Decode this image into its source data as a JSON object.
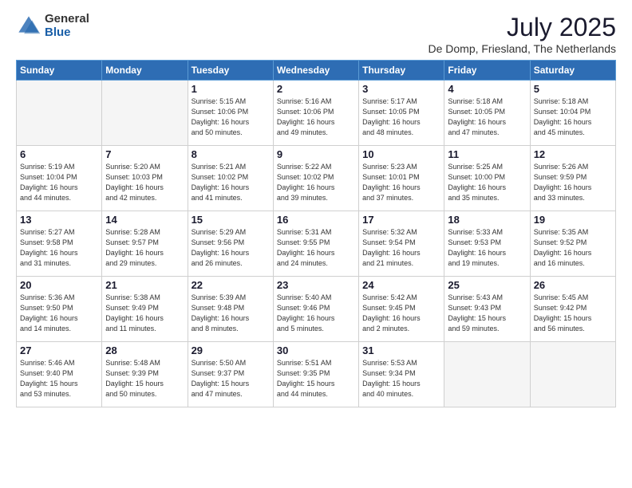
{
  "header": {
    "logo_general": "General",
    "logo_blue": "Blue",
    "title": "July 2025",
    "subtitle": "De Domp, Friesland, The Netherlands"
  },
  "days_of_week": [
    "Sunday",
    "Monday",
    "Tuesday",
    "Wednesday",
    "Thursday",
    "Friday",
    "Saturday"
  ],
  "weeks": [
    [
      {
        "day": "",
        "info": ""
      },
      {
        "day": "",
        "info": ""
      },
      {
        "day": "1",
        "info": "Sunrise: 5:15 AM\nSunset: 10:06 PM\nDaylight: 16 hours\nand 50 minutes."
      },
      {
        "day": "2",
        "info": "Sunrise: 5:16 AM\nSunset: 10:06 PM\nDaylight: 16 hours\nand 49 minutes."
      },
      {
        "day": "3",
        "info": "Sunrise: 5:17 AM\nSunset: 10:05 PM\nDaylight: 16 hours\nand 48 minutes."
      },
      {
        "day": "4",
        "info": "Sunrise: 5:18 AM\nSunset: 10:05 PM\nDaylight: 16 hours\nand 47 minutes."
      },
      {
        "day": "5",
        "info": "Sunrise: 5:18 AM\nSunset: 10:04 PM\nDaylight: 16 hours\nand 45 minutes."
      }
    ],
    [
      {
        "day": "6",
        "info": "Sunrise: 5:19 AM\nSunset: 10:04 PM\nDaylight: 16 hours\nand 44 minutes."
      },
      {
        "day": "7",
        "info": "Sunrise: 5:20 AM\nSunset: 10:03 PM\nDaylight: 16 hours\nand 42 minutes."
      },
      {
        "day": "8",
        "info": "Sunrise: 5:21 AM\nSunset: 10:02 PM\nDaylight: 16 hours\nand 41 minutes."
      },
      {
        "day": "9",
        "info": "Sunrise: 5:22 AM\nSunset: 10:02 PM\nDaylight: 16 hours\nand 39 minutes."
      },
      {
        "day": "10",
        "info": "Sunrise: 5:23 AM\nSunset: 10:01 PM\nDaylight: 16 hours\nand 37 minutes."
      },
      {
        "day": "11",
        "info": "Sunrise: 5:25 AM\nSunset: 10:00 PM\nDaylight: 16 hours\nand 35 minutes."
      },
      {
        "day": "12",
        "info": "Sunrise: 5:26 AM\nSunset: 9:59 PM\nDaylight: 16 hours\nand 33 minutes."
      }
    ],
    [
      {
        "day": "13",
        "info": "Sunrise: 5:27 AM\nSunset: 9:58 PM\nDaylight: 16 hours\nand 31 minutes."
      },
      {
        "day": "14",
        "info": "Sunrise: 5:28 AM\nSunset: 9:57 PM\nDaylight: 16 hours\nand 29 minutes."
      },
      {
        "day": "15",
        "info": "Sunrise: 5:29 AM\nSunset: 9:56 PM\nDaylight: 16 hours\nand 26 minutes."
      },
      {
        "day": "16",
        "info": "Sunrise: 5:31 AM\nSunset: 9:55 PM\nDaylight: 16 hours\nand 24 minutes."
      },
      {
        "day": "17",
        "info": "Sunrise: 5:32 AM\nSunset: 9:54 PM\nDaylight: 16 hours\nand 21 minutes."
      },
      {
        "day": "18",
        "info": "Sunrise: 5:33 AM\nSunset: 9:53 PM\nDaylight: 16 hours\nand 19 minutes."
      },
      {
        "day": "19",
        "info": "Sunrise: 5:35 AM\nSunset: 9:52 PM\nDaylight: 16 hours\nand 16 minutes."
      }
    ],
    [
      {
        "day": "20",
        "info": "Sunrise: 5:36 AM\nSunset: 9:50 PM\nDaylight: 16 hours\nand 14 minutes."
      },
      {
        "day": "21",
        "info": "Sunrise: 5:38 AM\nSunset: 9:49 PM\nDaylight: 16 hours\nand 11 minutes."
      },
      {
        "day": "22",
        "info": "Sunrise: 5:39 AM\nSunset: 9:48 PM\nDaylight: 16 hours\nand 8 minutes."
      },
      {
        "day": "23",
        "info": "Sunrise: 5:40 AM\nSunset: 9:46 PM\nDaylight: 16 hours\nand 5 minutes."
      },
      {
        "day": "24",
        "info": "Sunrise: 5:42 AM\nSunset: 9:45 PM\nDaylight: 16 hours\nand 2 minutes."
      },
      {
        "day": "25",
        "info": "Sunrise: 5:43 AM\nSunset: 9:43 PM\nDaylight: 15 hours\nand 59 minutes."
      },
      {
        "day": "26",
        "info": "Sunrise: 5:45 AM\nSunset: 9:42 PM\nDaylight: 15 hours\nand 56 minutes."
      }
    ],
    [
      {
        "day": "27",
        "info": "Sunrise: 5:46 AM\nSunset: 9:40 PM\nDaylight: 15 hours\nand 53 minutes."
      },
      {
        "day": "28",
        "info": "Sunrise: 5:48 AM\nSunset: 9:39 PM\nDaylight: 15 hours\nand 50 minutes."
      },
      {
        "day": "29",
        "info": "Sunrise: 5:50 AM\nSunset: 9:37 PM\nDaylight: 15 hours\nand 47 minutes."
      },
      {
        "day": "30",
        "info": "Sunrise: 5:51 AM\nSunset: 9:35 PM\nDaylight: 15 hours\nand 44 minutes."
      },
      {
        "day": "31",
        "info": "Sunrise: 5:53 AM\nSunset: 9:34 PM\nDaylight: 15 hours\nand 40 minutes."
      },
      {
        "day": "",
        "info": ""
      },
      {
        "day": "",
        "info": ""
      }
    ]
  ]
}
